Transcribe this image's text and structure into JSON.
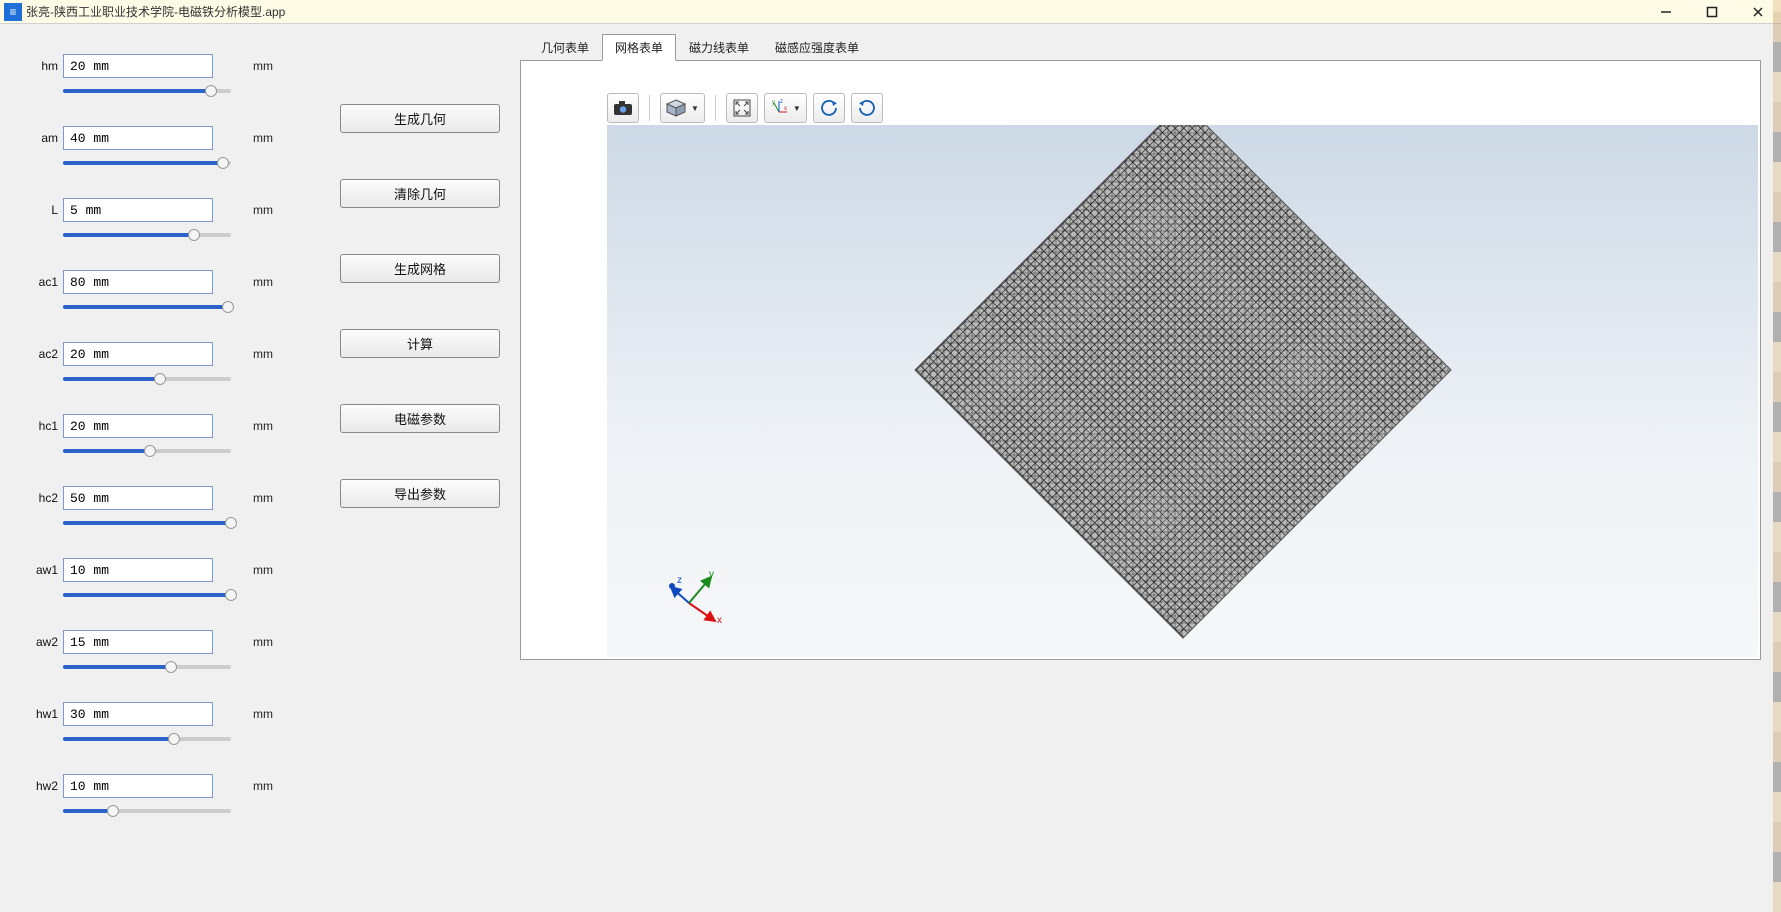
{
  "window": {
    "title": "张亮-陕西工业职业技术学院-电磁铁分析模型.app",
    "icon_glyph": "≡"
  },
  "params": [
    {
      "name": "hm",
      "value": "20 mm",
      "unit": "mm",
      "slider_pct": 88
    },
    {
      "name": "am",
      "value": "40 mm",
      "unit": "mm",
      "slider_pct": 95
    },
    {
      "name": "L",
      "value": "5 mm",
      "unit": "mm",
      "slider_pct": 78
    },
    {
      "name": "ac1",
      "value": "80 mm",
      "unit": "mm",
      "slider_pct": 98
    },
    {
      "name": "ac2",
      "value": "20 mm",
      "unit": "mm",
      "slider_pct": 58
    },
    {
      "name": "hc1",
      "value": "20 mm",
      "unit": "mm",
      "slider_pct": 52
    },
    {
      "name": "hc2",
      "value": "50 mm",
      "unit": "mm",
      "slider_pct": 100
    },
    {
      "name": "aw1",
      "value": "10 mm",
      "unit": "mm",
      "slider_pct": 100
    },
    {
      "name": "aw2",
      "value": "15 mm",
      "unit": "mm",
      "slider_pct": 64
    },
    {
      "name": "hw1",
      "value": "30 mm",
      "unit": "mm",
      "slider_pct": 66
    },
    {
      "name": "hw2",
      "value": "10 mm",
      "unit": "mm",
      "slider_pct": 30
    }
  ],
  "actions": {
    "gen_geom": "生成几何",
    "clear_geom": "清除几何",
    "gen_mesh": "生成网格",
    "compute": "计算",
    "em_params": "电磁参数",
    "export": "导出参数"
  },
  "tabs": [
    {
      "id": "geom",
      "label": "几何表单",
      "active": false
    },
    {
      "id": "mesh",
      "label": "网格表单",
      "active": true
    },
    {
      "id": "flux",
      "label": "磁力线表单",
      "active": false
    },
    {
      "id": "bfield",
      "label": "磁感应强度表单",
      "active": false
    }
  ],
  "viewer_toolbar": {
    "camera": "camera-icon",
    "cube": "view-cube-icon",
    "fit": "zoom-fit-icon",
    "axes": "axes-orientation-icon",
    "rot_ccw": "rotate-ccw-icon",
    "rot_cw": "rotate-cw-icon"
  },
  "triad": {
    "x": "x",
    "y": "y",
    "z": "z"
  }
}
